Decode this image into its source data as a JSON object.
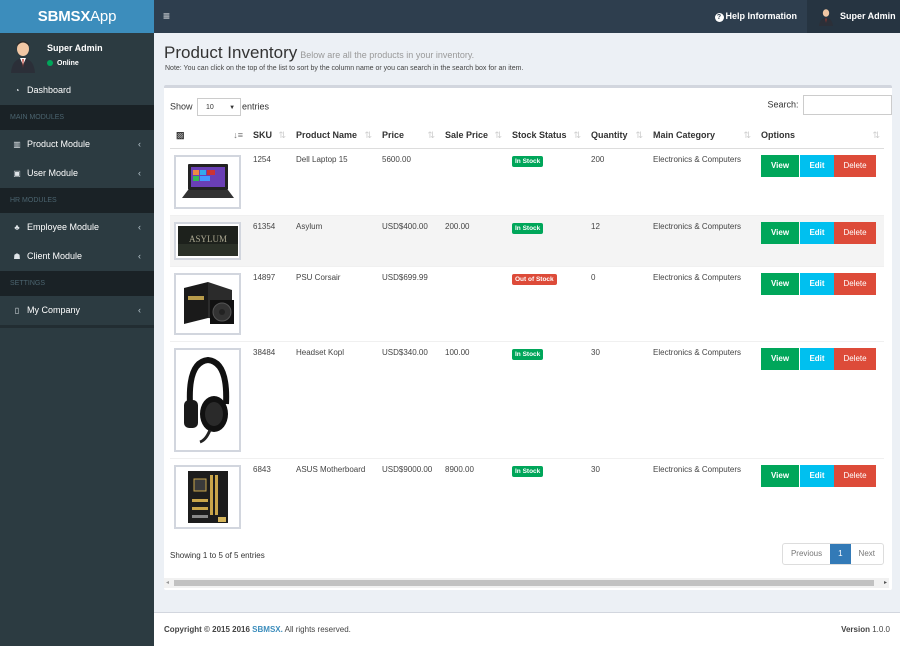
{
  "app": {
    "logo_bold": "SBMSX",
    "logo_light": "App"
  },
  "sidebar": {
    "user": {
      "name": "Super Admin",
      "status": "Online"
    },
    "sections": [
      {
        "type": "item",
        "icon": "dashboard-icon",
        "label": "Dashboard"
      },
      {
        "type": "header",
        "label": "MAIN MODULES"
      },
      {
        "type": "item",
        "icon": "barcode-icon",
        "label": "Product Module"
      },
      {
        "type": "item",
        "icon": "lock-icon",
        "label": "User Module"
      },
      {
        "type": "header",
        "label": "HR MODULES"
      },
      {
        "type": "item",
        "icon": "sitemap-icon",
        "label": "Employee Module"
      },
      {
        "type": "item",
        "icon": "users-icon",
        "label": "Client Module"
      },
      {
        "type": "header",
        "label": "SETTINGS"
      },
      {
        "type": "item",
        "icon": "building-icon",
        "label": "My Company"
      }
    ]
  },
  "topbar": {
    "help_label": "Help Information",
    "user_name": "Super Admin"
  },
  "page": {
    "title": "Product Inventory",
    "subtitle": "Below are all the products in your inventory.",
    "note": "Note: You can click on the top of the list to sort by the column name or you can search in the search box for an item."
  },
  "table_controls": {
    "show_label": "Show",
    "entries_value": "10",
    "entries_label": "entries",
    "search_label": "Search:",
    "search_value": ""
  },
  "table": {
    "columns": [
      "",
      "SKU",
      "Product Name",
      "Price",
      "Sale Price",
      "Stock Status",
      "Quantity",
      "Main Category",
      "Options"
    ],
    "rows": [
      {
        "image": "laptop",
        "sku": "1254",
        "name": "Dell Laptop 15",
        "price": "5600.00",
        "sale_price": "",
        "status": "In Stock",
        "status_type": "in",
        "quantity": "200",
        "category": "Electronics & Computers"
      },
      {
        "image": "game",
        "sku": "61354",
        "name": "Asylum",
        "price": "USD$400.00",
        "sale_price": "200.00",
        "status": "In Stock",
        "status_type": "in",
        "quantity": "12",
        "category": "Electronics & Computers"
      },
      {
        "image": "psu",
        "sku": "14897",
        "name": "PSU Corsair",
        "price": "USD$699.99",
        "sale_price": "",
        "status": "Out of Stock",
        "status_type": "out",
        "quantity": "0",
        "category": "Electronics & Computers"
      },
      {
        "image": "headset",
        "sku": "38484",
        "name": "Headset Kopl",
        "price": "USD$340.00",
        "sale_price": "100.00",
        "status": "In Stock",
        "status_type": "in",
        "quantity": "30",
        "category": "Electronics & Computers"
      },
      {
        "image": "motherboard",
        "sku": "6843",
        "name": "ASUS Motherboard",
        "price": "USD$9000.00",
        "sale_price": "8900.00",
        "status": "In Stock",
        "status_type": "in",
        "quantity": "30",
        "category": "Electronics & Computers"
      }
    ],
    "actions": {
      "view": "View",
      "edit": "Edit",
      "delete": "Delete"
    }
  },
  "pagination": {
    "info": "Showing 1 to 5 of 5 entries",
    "previous": "Previous",
    "current": "1",
    "next": "Next"
  },
  "footer": {
    "copyright": "Copyright © 2015 2016",
    "brand": "SBMSX.",
    "rights": "All rights reserved.",
    "version_label": "Version",
    "version": "1.0.0"
  },
  "colors": {
    "primary": "#3c8dbc",
    "success": "#00a65a",
    "info": "#00c0ef",
    "danger": "#dd4b39",
    "sidebar": "#2c3b41"
  }
}
